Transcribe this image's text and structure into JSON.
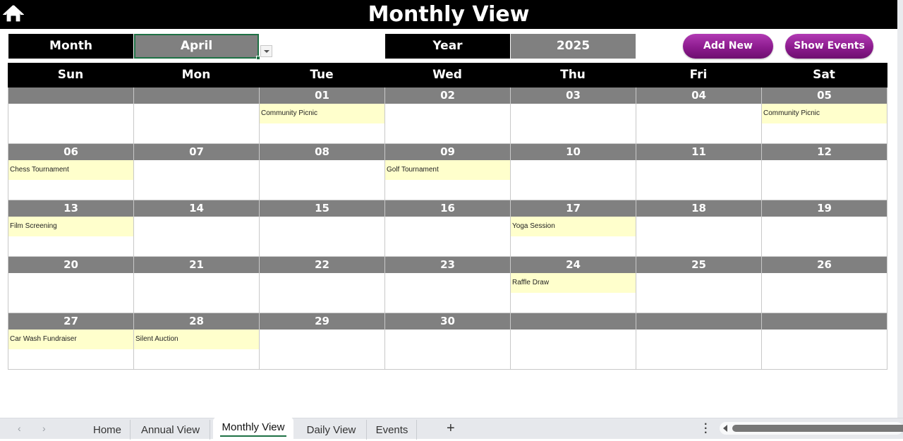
{
  "header": {
    "title": "Monthly View",
    "home_icon": "home-icon"
  },
  "controls": {
    "month_label": "Month",
    "month_value": "April",
    "year_label": "Year",
    "year_value": "2025",
    "add_new_label": "Add New",
    "show_events_label": "Show Events"
  },
  "colors": {
    "header_bg": "#000000",
    "day_number_bg": "#808080",
    "event_bg": "#ffffcc",
    "button_purple": "#8c1b8e",
    "active_tab_underline": "#1e7145"
  },
  "calendar": {
    "weekdays": [
      "Sun",
      "Mon",
      "Tue",
      "Wed",
      "Thu",
      "Fri",
      "Sat"
    ],
    "weeks": [
      [
        {
          "day": "",
          "event": ""
        },
        {
          "day": "",
          "event": ""
        },
        {
          "day": "01",
          "event": "Community Picnic"
        },
        {
          "day": "02",
          "event": ""
        },
        {
          "day": "03",
          "event": ""
        },
        {
          "day": "04",
          "event": ""
        },
        {
          "day": "05",
          "event": "Community Picnic"
        }
      ],
      [
        {
          "day": "06",
          "event": "Chess Tournament"
        },
        {
          "day": "07",
          "event": ""
        },
        {
          "day": "08",
          "event": ""
        },
        {
          "day": "09",
          "event": "Golf Tournament"
        },
        {
          "day": "10",
          "event": ""
        },
        {
          "day": "11",
          "event": ""
        },
        {
          "day": "12",
          "event": ""
        }
      ],
      [
        {
          "day": "13",
          "event": "Film Screening"
        },
        {
          "day": "14",
          "event": ""
        },
        {
          "day": "15",
          "event": ""
        },
        {
          "day": "16",
          "event": ""
        },
        {
          "day": "17",
          "event": "Yoga Session"
        },
        {
          "day": "18",
          "event": ""
        },
        {
          "day": "19",
          "event": ""
        }
      ],
      [
        {
          "day": "20",
          "event": ""
        },
        {
          "day": "21",
          "event": ""
        },
        {
          "day": "22",
          "event": ""
        },
        {
          "day": "23",
          "event": ""
        },
        {
          "day": "24",
          "event": "Raffle Draw"
        },
        {
          "day": "25",
          "event": ""
        },
        {
          "day": "26",
          "event": ""
        }
      ],
      [
        {
          "day": "27",
          "event": "Car Wash Fundraiser"
        },
        {
          "day": "28",
          "event": "Silent Auction"
        },
        {
          "day": "29",
          "event": ""
        },
        {
          "day": "30",
          "event": ""
        },
        {
          "day": "",
          "event": ""
        },
        {
          "day": "",
          "event": ""
        },
        {
          "day": "",
          "event": ""
        }
      ]
    ]
  },
  "sheet_tabs": {
    "tabs": [
      {
        "label": "Home",
        "active": false
      },
      {
        "label": "Annual View",
        "active": false
      },
      {
        "label": "Monthly View",
        "active": true
      },
      {
        "label": "Daily View",
        "active": false
      },
      {
        "label": "Events",
        "active": false
      }
    ],
    "prev_icon": "chevron-left-icon",
    "next_icon": "chevron-right-icon",
    "add_sheet_label": "+",
    "more_icon": "more-vertical-icon"
  }
}
